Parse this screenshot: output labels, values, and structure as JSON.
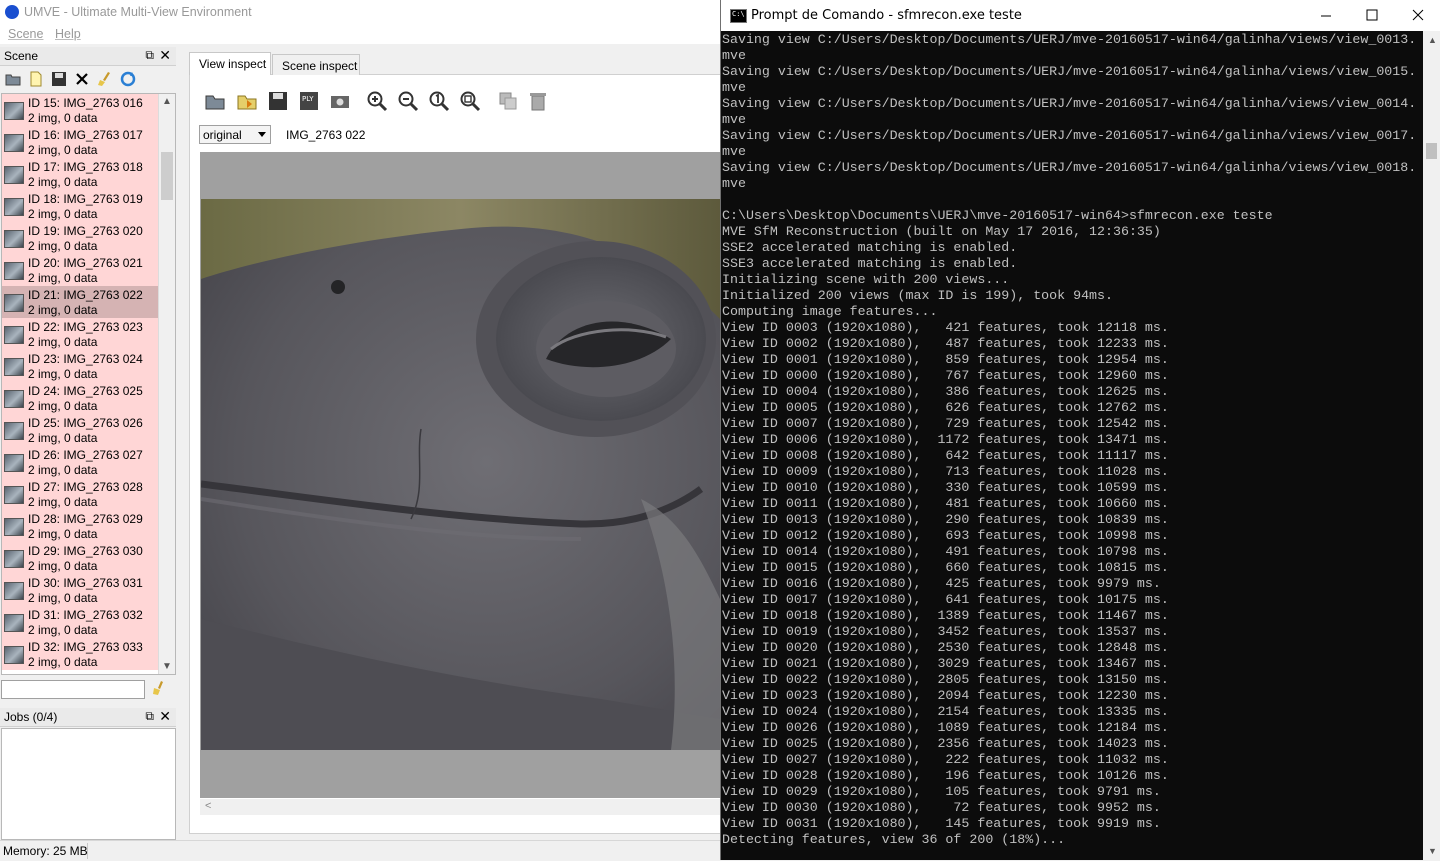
{
  "window": {
    "title": "UMVE - Ultimate Multi-View Environment"
  },
  "menu": {
    "scene": "Scene",
    "help": "Help"
  },
  "scene_dock": {
    "title": "Scene",
    "items": [
      {
        "name": "ID 15: IMG_2763 016",
        "info": "2 img, 0 data"
      },
      {
        "name": "ID 16: IMG_2763 017",
        "info": "2 img, 0 data"
      },
      {
        "name": "ID 17: IMG_2763 018",
        "info": "2 img, 0 data"
      },
      {
        "name": "ID 18: IMG_2763 019",
        "info": "2 img, 0 data"
      },
      {
        "name": "ID 19: IMG_2763 020",
        "info": "2 img, 0 data"
      },
      {
        "name": "ID 20: IMG_2763 021",
        "info": "2 img, 0 data"
      },
      {
        "name": "ID 21: IMG_2763 022",
        "info": "2 img, 0 data"
      },
      {
        "name": "ID 22: IMG_2763 023",
        "info": "2 img, 0 data"
      },
      {
        "name": "ID 23: IMG_2763 024",
        "info": "2 img, 0 data"
      },
      {
        "name": "ID 24: IMG_2763 025",
        "info": "2 img, 0 data"
      },
      {
        "name": "ID 25: IMG_2763 026",
        "info": "2 img, 0 data"
      },
      {
        "name": "ID 26: IMG_2763 027",
        "info": "2 img, 0 data"
      },
      {
        "name": "ID 27: IMG_2763 028",
        "info": "2 img, 0 data"
      },
      {
        "name": "ID 28: IMG_2763 029",
        "info": "2 img, 0 data"
      },
      {
        "name": "ID 29: IMG_2763 030",
        "info": "2 img, 0 data"
      },
      {
        "name": "ID 30: IMG_2763 031",
        "info": "2 img, 0 data"
      },
      {
        "name": "ID 31: IMG_2763 032",
        "info": "2 img, 0 data"
      },
      {
        "name": "ID 32: IMG_2763 033",
        "info": "2 img, 0 data"
      }
    ],
    "selected_index": 6,
    "filter_value": ""
  },
  "jobs_dock": {
    "title": "Jobs (0/4)"
  },
  "status": {
    "memory": "Memory: 25 MB"
  },
  "tabs": [
    {
      "label": "View inspect",
      "active": true
    },
    {
      "label": "Scene inspect",
      "active": false
    }
  ],
  "view": {
    "image_mode": "original",
    "image_name": "IMG_2763 022"
  },
  "colors": {
    "list_item_bg": "#ffd6d6",
    "list_item_selected_bg": "#d5b3b3",
    "console_bg": "#0c0c0c",
    "console_text": "#c0c0c0"
  },
  "cmd": {
    "title": "Prompt de Comando - sfmrecon.exe  teste",
    "lines": [
      "Saving view C:/Users/Desktop/Documents/UERJ/mve-20160517-win64/galinha/views/view_0013.",
      "mve",
      "Saving view C:/Users/Desktop/Documents/UERJ/mve-20160517-win64/galinha/views/view_0015.",
      "mve",
      "Saving view C:/Users/Desktop/Documents/UERJ/mve-20160517-win64/galinha/views/view_0014.",
      "mve",
      "Saving view C:/Users/Desktop/Documents/UERJ/mve-20160517-win64/galinha/views/view_0017.",
      "mve",
      "Saving view C:/Users/Desktop/Documents/UERJ/mve-20160517-win64/galinha/views/view_0018.",
      "mve",
      "",
      "C:\\Users\\Desktop\\Documents\\UERJ\\mve-20160517-win64>sfmrecon.exe teste",
      "MVE SfM Reconstruction (built on May 17 2016, 12:36:35)",
      "SSE2 accelerated matching is enabled.",
      "SSE3 accelerated matching is enabled.",
      "Initializing scene with 200 views...",
      "Initialized 200 views (max ID is 199), took 94ms.",
      "Computing image features...",
      "View ID 0003 (1920x1080),   421 features, took 12118 ms.",
      "View ID 0002 (1920x1080),   487 features, took 12233 ms.",
      "View ID 0001 (1920x1080),   859 features, took 12954 ms.",
      "View ID 0000 (1920x1080),   767 features, took 12960 ms.",
      "View ID 0004 (1920x1080),   386 features, took 12625 ms.",
      "View ID 0005 (1920x1080),   626 features, took 12762 ms.",
      "View ID 0007 (1920x1080),   729 features, took 12542 ms.",
      "View ID 0006 (1920x1080),  1172 features, took 13471 ms.",
      "View ID 0008 (1920x1080),   642 features, took 11117 ms.",
      "View ID 0009 (1920x1080),   713 features, took 11028 ms.",
      "View ID 0010 (1920x1080),   330 features, took 10599 ms.",
      "View ID 0011 (1920x1080),   481 features, took 10660 ms.",
      "View ID 0013 (1920x1080),   290 features, took 10839 ms.",
      "View ID 0012 (1920x1080),   693 features, took 10998 ms.",
      "View ID 0014 (1920x1080),   491 features, took 10798 ms.",
      "View ID 0015 (1920x1080),   660 features, took 10815 ms.",
      "View ID 0016 (1920x1080),   425 features, took 9979 ms.",
      "View ID 0017 (1920x1080),   641 features, took 10175 ms.",
      "View ID 0018 (1920x1080),  1389 features, took 11467 ms.",
      "View ID 0019 (1920x1080),  3452 features, took 13537 ms.",
      "View ID 0020 (1920x1080),  2530 features, took 12848 ms.",
      "View ID 0021 (1920x1080),  3029 features, took 13467 ms.",
      "View ID 0022 (1920x1080),  2805 features, took 13150 ms.",
      "View ID 0023 (1920x1080),  2094 features, took 12230 ms.",
      "View ID 0024 (1920x1080),  2154 features, took 13335 ms.",
      "View ID 0026 (1920x1080),  1089 features, took 12184 ms.",
      "View ID 0025 (1920x1080),  2356 features, took 14023 ms.",
      "View ID 0027 (1920x1080),   222 features, took 11032 ms.",
      "View ID 0028 (1920x1080),   196 features, took 10126 ms.",
      "View ID 0029 (1920x1080),   105 features, took 9791 ms.",
      "View ID 0030 (1920x1080),    72 features, took 9952 ms.",
      "View ID 0031 (1920x1080),   145 features, took 9919 ms.",
      "Detecting features, view 36 of 200 (18%)..."
    ]
  }
}
